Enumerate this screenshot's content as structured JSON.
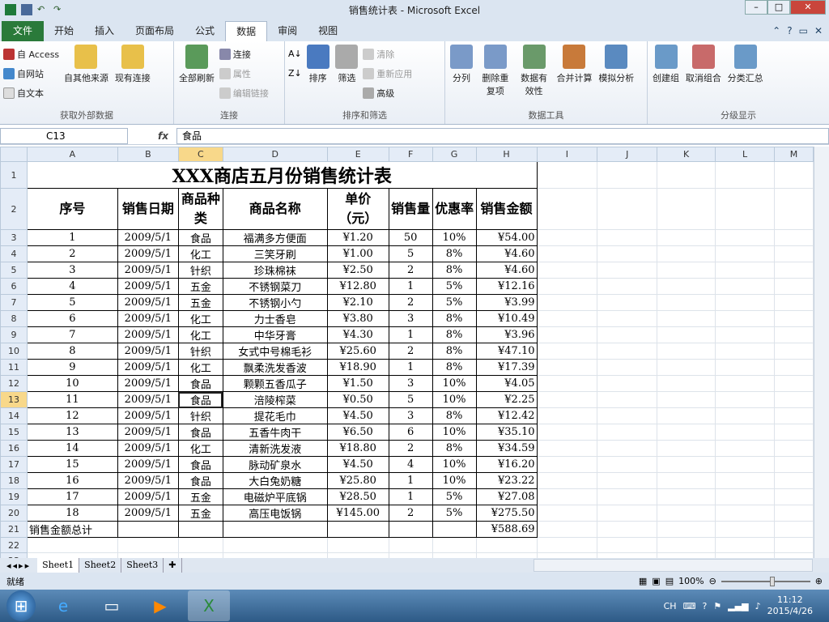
{
  "window": {
    "title": "销售统计表 - Microsoft Excel"
  },
  "tabs": [
    "文件",
    "开始",
    "插入",
    "页面布局",
    "公式",
    "数据",
    "审阅",
    "视图"
  ],
  "ribbon": {
    "groups": [
      {
        "label": "获取外部数据",
        "items": [
          "自 Access",
          "自网站",
          "自文本",
          "自其他来源",
          "现有连接"
        ]
      },
      {
        "label": "连接",
        "items": [
          "全部刷新",
          "连接",
          "属性",
          "编辑链接"
        ]
      },
      {
        "label": "排序和筛选",
        "items": [
          "排序",
          "筛选",
          "清除",
          "重新应用",
          "高级"
        ]
      },
      {
        "label": "数据工具",
        "items": [
          "分列",
          "删除重复项",
          "数据有效性",
          "合并计算",
          "模拟分析"
        ]
      },
      {
        "label": "分级显示",
        "items": [
          "创建组",
          "取消组合",
          "分类汇总"
        ]
      }
    ]
  },
  "formula": {
    "cell": "C13",
    "fx": "fx",
    "value": "食品"
  },
  "columns": [
    "A",
    "B",
    "C",
    "D",
    "E",
    "F",
    "G",
    "H",
    "I",
    "J",
    "K",
    "L",
    "M"
  ],
  "sheet": {
    "title": "XXX商店五月份销售统计表",
    "headers": [
      "序号",
      "销售日期",
      "商品种类",
      "商品名称",
      "单价（元）",
      "销售量",
      "优惠率",
      "销售金额"
    ],
    "rows": [
      [
        "1",
        "2009/5/1",
        "食品",
        "福满多方便面",
        "¥1.20",
        "50",
        "10%",
        "¥54.00"
      ],
      [
        "2",
        "2009/5/1",
        "化工",
        "三笑牙刷",
        "¥1.00",
        "5",
        "8%",
        "¥4.60"
      ],
      [
        "3",
        "2009/5/1",
        "针织",
        "珍珠棉袜",
        "¥2.50",
        "2",
        "8%",
        "¥4.60"
      ],
      [
        "4",
        "2009/5/1",
        "五金",
        "不锈钢菜刀",
        "¥12.80",
        "1",
        "5%",
        "¥12.16"
      ],
      [
        "5",
        "2009/5/1",
        "五金",
        "不锈钢小勺",
        "¥2.10",
        "2",
        "5%",
        "¥3.99"
      ],
      [
        "6",
        "2009/5/1",
        "化工",
        "力士香皂",
        "¥3.80",
        "3",
        "8%",
        "¥10.49"
      ],
      [
        "7",
        "2009/5/1",
        "化工",
        "中华牙膏",
        "¥4.30",
        "1",
        "8%",
        "¥3.96"
      ],
      [
        "8",
        "2009/5/1",
        "针织",
        "女式中号棉毛衫",
        "¥25.60",
        "2",
        "8%",
        "¥47.10"
      ],
      [
        "9",
        "2009/5/1",
        "化工",
        "飘柔洗发香波",
        "¥18.90",
        "1",
        "8%",
        "¥17.39"
      ],
      [
        "10",
        "2009/5/1",
        "食品",
        "颗颗五香瓜子",
        "¥1.50",
        "3",
        "10%",
        "¥4.05"
      ],
      [
        "11",
        "2009/5/1",
        "食品",
        "涪陵榨菜",
        "¥0.50",
        "5",
        "10%",
        "¥2.25"
      ],
      [
        "12",
        "2009/5/1",
        "针织",
        "提花毛巾",
        "¥4.50",
        "3",
        "8%",
        "¥12.42"
      ],
      [
        "13",
        "2009/5/1",
        "食品",
        "五香牛肉干",
        "¥6.50",
        "6",
        "10%",
        "¥35.10"
      ],
      [
        "14",
        "2009/5/1",
        "化工",
        "清新洗发液",
        "¥18.80",
        "2",
        "8%",
        "¥34.59"
      ],
      [
        "15",
        "2009/5/1",
        "食品",
        "脉动矿泉水",
        "¥4.50",
        "4",
        "10%",
        "¥16.20"
      ],
      [
        "16",
        "2009/5/1",
        "食品",
        "大白兔奶糖",
        "¥25.80",
        "1",
        "10%",
        "¥23.22"
      ],
      [
        "17",
        "2009/5/1",
        "五金",
        "电磁炉平底锅",
        "¥28.50",
        "1",
        "5%",
        "¥27.08"
      ],
      [
        "18",
        "2009/5/1",
        "五金",
        "高压电饭锅",
        "¥145.00",
        "2",
        "5%",
        "¥275.50"
      ]
    ],
    "total_label": "销售金额总计",
    "total_value": "¥588.69"
  },
  "sheet_tabs": [
    "Sheet1",
    "Sheet2",
    "Sheet3"
  ],
  "status": {
    "ready": "就绪",
    "zoom": "100%"
  },
  "taskbar": {
    "lang": "CH",
    "time": "11:12",
    "date": "2015/4/26"
  }
}
